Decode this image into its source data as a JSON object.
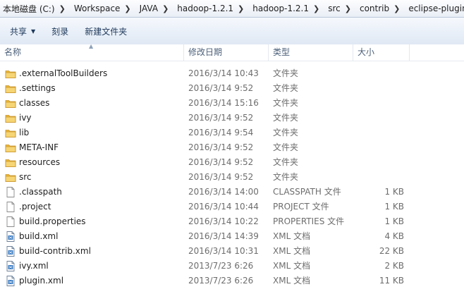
{
  "breadcrumb": [
    {
      "label": "本地磁盘 (C:)"
    },
    {
      "label": "Workspace"
    },
    {
      "label": "JAVA"
    },
    {
      "label": "hadoop-1.2.1"
    },
    {
      "label": "hadoop-1.2.1"
    },
    {
      "label": "src"
    },
    {
      "label": "contrib"
    },
    {
      "label": "eclipse-plugin"
    }
  ],
  "toolbar": {
    "share_label": "共享",
    "burn_label": "刻录",
    "new_folder_label": "新建文件夹"
  },
  "columns": {
    "name": "名称",
    "date": "修改日期",
    "type": "类型",
    "size": "大小"
  },
  "files": [
    {
      "name": ".externalToolBuilders",
      "date": "2016/3/14 10:43",
      "type": "文件夹",
      "size": "",
      "icon": "folder-icon"
    },
    {
      "name": ".settings",
      "date": "2016/3/14 9:52",
      "type": "文件夹",
      "size": "",
      "icon": "folder-icon"
    },
    {
      "name": "classes",
      "date": "2016/3/14 15:16",
      "type": "文件夹",
      "size": "",
      "icon": "folder-icon"
    },
    {
      "name": "ivy",
      "date": "2016/3/14 9:52",
      "type": "文件夹",
      "size": "",
      "icon": "folder-icon"
    },
    {
      "name": "lib",
      "date": "2016/3/14 9:54",
      "type": "文件夹",
      "size": "",
      "icon": "folder-icon"
    },
    {
      "name": "META-INF",
      "date": "2016/3/14 9:52",
      "type": "文件夹",
      "size": "",
      "icon": "folder-icon"
    },
    {
      "name": "resources",
      "date": "2016/3/14 9:52",
      "type": "文件夹",
      "size": "",
      "icon": "folder-icon"
    },
    {
      "name": "src",
      "date": "2016/3/14 9:52",
      "type": "文件夹",
      "size": "",
      "icon": "folder-icon"
    },
    {
      "name": ".classpath",
      "date": "2016/3/14 14:00",
      "type": "CLASSPATH 文件",
      "size": "1 KB",
      "icon": "file-icon"
    },
    {
      "name": ".project",
      "date": "2016/3/14 10:44",
      "type": "PROJECT 文件",
      "size": "1 KB",
      "icon": "file-icon"
    },
    {
      "name": "build.properties",
      "date": "2016/3/14 10:22",
      "type": "PROPERTIES 文件",
      "size": "1 KB",
      "icon": "file-icon"
    },
    {
      "name": "build.xml",
      "date": "2016/3/14 14:39",
      "type": "XML 文档",
      "size": "4 KB",
      "icon": "xml-file-icon"
    },
    {
      "name": "build-contrib.xml",
      "date": "2016/3/14 10:31",
      "type": "XML 文档",
      "size": "22 KB",
      "icon": "xml-file-icon"
    },
    {
      "name": "ivy.xml",
      "date": "2013/7/23 6:26",
      "type": "XML 文档",
      "size": "2 KB",
      "icon": "xml-file-icon"
    },
    {
      "name": "plugin.xml",
      "date": "2013/7/23 6:26",
      "type": "XML 文档",
      "size": "11 KB",
      "icon": "xml-file-icon"
    }
  ]
}
